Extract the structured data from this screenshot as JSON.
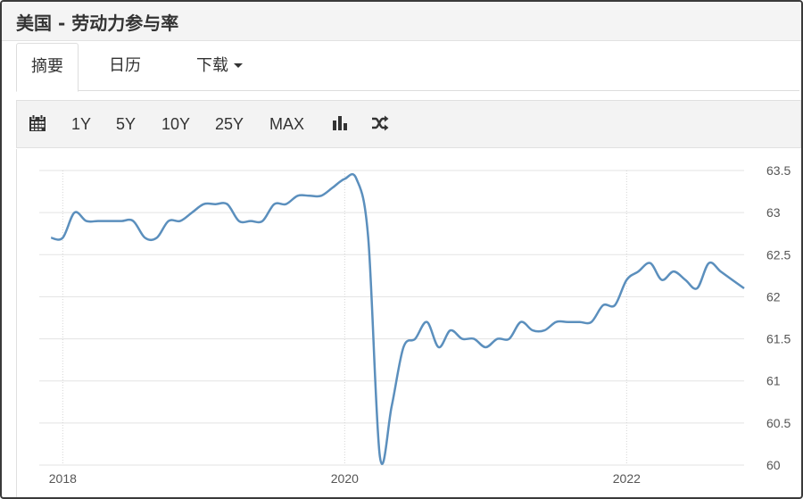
{
  "header": {
    "title": "美国 - 劳动力参与率"
  },
  "tabs": [
    {
      "label": "摘要",
      "active": true
    },
    {
      "label": "日历"
    },
    {
      "label": "下载"
    }
  ],
  "toolbar": {
    "ranges": [
      "1Y",
      "5Y",
      "10Y",
      "25Y",
      "MAX"
    ],
    "icons": [
      "calendar-icon",
      "bar-chart-icon",
      "shuffle-icon"
    ]
  },
  "colors": {
    "line": "#5b8fbd",
    "grid": "#e3e3e3",
    "tick": "#555555"
  },
  "chart_data": {
    "type": "line",
    "title": "",
    "xlabel": "",
    "ylabel": "",
    "ylim": [
      60,
      63.5
    ],
    "xlim": [
      "2017-11",
      "2022-11"
    ],
    "x_ticks": [
      "2018",
      "2020",
      "2022"
    ],
    "y_ticks": [
      "60",
      "60.5",
      "61",
      "61.5",
      "62",
      "62.5",
      "63",
      "63.5"
    ],
    "grid": true,
    "series": [
      {
        "x": [
          "2017-12",
          "2018-01",
          "2018-02",
          "2018-03",
          "2018-04",
          "2018-05",
          "2018-06",
          "2018-07",
          "2018-08",
          "2018-09",
          "2018-10",
          "2018-11",
          "2018-12",
          "2019-01",
          "2019-02",
          "2019-03",
          "2019-04",
          "2019-05",
          "2019-06",
          "2019-07",
          "2019-08",
          "2019-09",
          "2019-10",
          "2019-11",
          "2019-12",
          "2020-01",
          "2020-02",
          "2020-03",
          "2020-04",
          "2020-05",
          "2020-06",
          "2020-07",
          "2020-08",
          "2020-09",
          "2020-10",
          "2020-11",
          "2020-12",
          "2021-01",
          "2021-02",
          "2021-03",
          "2021-04",
          "2021-05",
          "2021-06",
          "2021-07",
          "2021-08",
          "2021-09",
          "2021-10",
          "2021-11",
          "2021-12",
          "2022-01",
          "2022-02",
          "2022-03",
          "2022-04",
          "2022-05",
          "2022-06",
          "2022-07",
          "2022-08",
          "2022-09",
          "2022-10"
        ],
        "values": [
          62.7,
          62.7,
          63.0,
          62.9,
          62.9,
          62.9,
          62.9,
          62.9,
          62.7,
          62.7,
          62.9,
          62.9,
          63.0,
          63.1,
          63.1,
          63.1,
          62.9,
          62.9,
          62.9,
          63.1,
          63.1,
          63.2,
          63.2,
          63.2,
          63.3,
          63.4,
          63.4,
          62.7,
          60.1,
          60.7,
          61.4,
          61.5,
          61.7,
          61.4,
          61.6,
          61.5,
          61.5,
          61.4,
          61.5,
          61.5,
          61.7,
          61.6,
          61.6,
          61.7,
          61.7,
          61.7,
          61.7,
          61.9,
          61.9,
          62.2,
          62.3,
          62.4,
          62.2,
          62.3,
          62.2,
          62.1,
          62.4,
          62.3,
          62.2
        ]
      }
    ],
    "last_point": {
      "x": "2022-11",
      "value": 62.1
    }
  }
}
